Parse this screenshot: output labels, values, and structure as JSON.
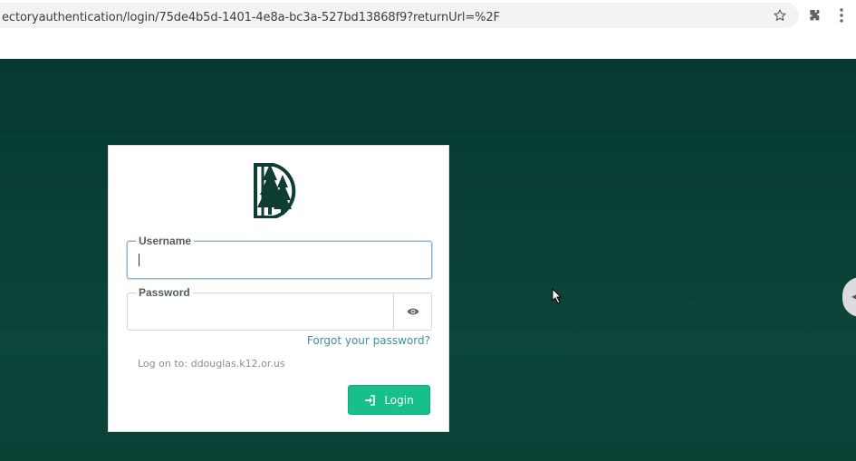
{
  "browser": {
    "url": "ectoryauthentication/login/75de4b5d-1401-4e8a-bc3a-527bd13868f9?returnUrl=%2F",
    "icons": [
      "star-icon",
      "extensions-icon",
      "menu-icon"
    ]
  },
  "login": {
    "username_label": "Username",
    "username_value": "",
    "password_label": "Password",
    "password_value": "",
    "forgot_label": "Forgot your password?",
    "logon_text": "Log on to: ddouglas.k12.or.us",
    "login_button": "Login"
  },
  "colors": {
    "background": "#0a3f35",
    "button": "#17c08a",
    "link": "#3f8fa8",
    "logo": "#0f3d33"
  }
}
